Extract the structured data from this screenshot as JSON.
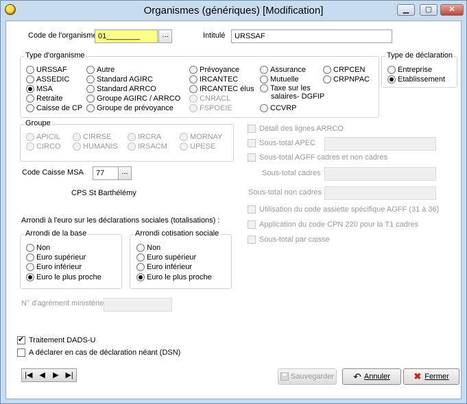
{
  "window": {
    "title": "Organismes (génériques)   [Modification]",
    "minimize": "▁",
    "maximize": "▢",
    "close": "✕"
  },
  "code_organisme": {
    "label": "Code de l'organisme",
    "value": "01________",
    "lookup": "..."
  },
  "intitule": {
    "label": "Intitulé",
    "value": "URSSAF"
  },
  "type_organisme": {
    "legend": "Type d'organisme",
    "options": [
      {
        "label": "URSSAF",
        "checked": false,
        "enabled": true
      },
      {
        "label": "ASSEDIC",
        "checked": false,
        "enabled": true
      },
      {
        "label": "MSA",
        "checked": true,
        "enabled": true
      },
      {
        "label": "Retraite",
        "checked": false,
        "enabled": true
      },
      {
        "label": "Caisse de CP",
        "checked": false,
        "enabled": true
      },
      {
        "label": "Autre",
        "checked": false,
        "enabled": true
      },
      {
        "label": "Standard AGIRC",
        "checked": false,
        "enabled": true
      },
      {
        "label": "Standard ARRCO",
        "checked": false,
        "enabled": true
      },
      {
        "label": "Groupe AGIRC / ARRCO",
        "checked": false,
        "enabled": true
      },
      {
        "label": "Groupe de prévoyance",
        "checked": false,
        "enabled": true
      },
      {
        "label": "Prévoyance",
        "checked": false,
        "enabled": true
      },
      {
        "label": "IRCANTEC",
        "checked": false,
        "enabled": true
      },
      {
        "label": "IRCANTEC élus",
        "checked": false,
        "enabled": true
      },
      {
        "label": "CNRACL",
        "checked": false,
        "enabled": false
      },
      {
        "label": "FSPOEIE",
        "checked": false,
        "enabled": false
      },
      {
        "label": "Assurance",
        "checked": false,
        "enabled": true
      },
      {
        "label": "Mutuelle",
        "checked": false,
        "enabled": true
      },
      {
        "label": "Taxe sur les",
        "checked": false,
        "enabled": true
      },
      {
        "label": "salaires- DGFIP",
        "checked": false,
        "enabled": true
      },
      {
        "label": "CCVRP",
        "checked": false,
        "enabled": true
      },
      {
        "label": "CRPCEN",
        "checked": false,
        "enabled": true
      },
      {
        "label": "CRPNPAC",
        "checked": false,
        "enabled": true
      }
    ]
  },
  "type_declaration": {
    "legend": "Type de déclaration",
    "options": [
      {
        "label": "Entreprise",
        "checked": false
      },
      {
        "label": "Etablissement",
        "checked": true
      }
    ]
  },
  "groupe": {
    "legend": "Groupe",
    "options": [
      "APICIL",
      "CIRCO",
      "CIRRSE",
      "HUMANIS",
      "IRCRA",
      "IRSACM",
      "MORNAY",
      "UPESE"
    ]
  },
  "caisse_msa": {
    "label": "Code Caisse MSA",
    "value": "77",
    "lookup": "...",
    "name": "CPS St Barthélémy"
  },
  "arrondi": {
    "title": "Arrondi à l'euro sur les déclarations sociales (totalisations) :",
    "base": {
      "legend": "Arrondi de la base",
      "options": [
        {
          "label": "Non",
          "checked": false
        },
        {
          "label": "Euro supérieur",
          "checked": false
        },
        {
          "label": "Euro inférieur",
          "checked": false
        },
        {
          "label": "Euro le plus proche",
          "checked": true
        }
      ]
    },
    "cotisation": {
      "legend": "Arrondi cotisation sociale",
      "options": [
        {
          "label": "Non",
          "checked": false
        },
        {
          "label": "Euro supérieur",
          "checked": false
        },
        {
          "label": "Euro inférieur",
          "checked": false
        },
        {
          "label": "Euro le plus proche",
          "checked": true
        }
      ]
    }
  },
  "agrement": {
    "label": "N° d'agrément ministériel",
    "value": ""
  },
  "right_panel": {
    "detail_arrco": "Détail des lignes ARRCO",
    "sous_total_apec": "Sous-total APEC",
    "sous_total_agff": "Sous-total AGFF cadres et non cadres",
    "sous_total_cadres": "Sous-total cadres",
    "sous_total_non_cadres": "Sous-total non cadres",
    "utilisation_agff": "Utilisation du code assiette spécifique AGFF (31 à 36)",
    "application_cpn": "Application du code CPN 220 pour la T1 cadres",
    "sous_total_caisse": "Sous-total par caisse"
  },
  "traitement_dads": {
    "label": "Traitement DADS-U",
    "checked": true
  },
  "declarer_neant": {
    "label": "A déclarer en cas de déclaration néant (DSN)",
    "checked": false
  },
  "nav": {
    "first": "|◀",
    "prev": "◀",
    "next": "▶",
    "last": "▶|"
  },
  "buttons": {
    "save": {
      "label": "Sauvegarder",
      "enabled": false
    },
    "cancel": {
      "label": "Annuler"
    },
    "close": {
      "label": "Fermer"
    }
  },
  "colors": {
    "required_field": "#ffff84",
    "close_icon": "#d42020",
    "window_frame": "#c8dcf0"
  }
}
